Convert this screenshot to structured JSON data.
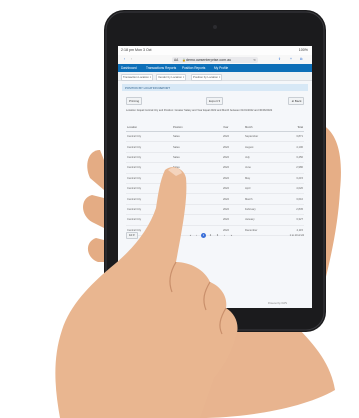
{
  "status": {
    "time": "2:18 pm  Mon 3 Oct",
    "battery": "100%"
  },
  "browser": {
    "tabs_label": "AA",
    "url": "demo.owsenterprise.com.au"
  },
  "nav": {
    "items": [
      "Dashboard",
      "Transactions Reports",
      "Position Reports",
      "My Profile"
    ]
  },
  "tabs": [
    {
      "label": "Transaction Location ×"
    },
    {
      "label": "Vendor by Location ×"
    },
    {
      "label": "Position by Location ×"
    }
  ],
  "panel": {
    "title": "POSITION BY LOCATION REPORT"
  },
  "toolbar": {
    "printing": "Printing",
    "export": "Export ▾",
    "back": "◄ Back"
  },
  "filter_text": "Location: Equal Central City and Position: Greater Salary and Year Equal 2022 and Month between 01/01/2022 and 30/06/2022",
  "table": {
    "headers": [
      "Location",
      "Position",
      "Year",
      "Month",
      "Total"
    ],
    "rows": [
      [
        "Central City",
        "Sales",
        "2022",
        "September",
        "3,871"
      ],
      [
        "Central City",
        "Sales",
        "2022",
        "August",
        "4,100"
      ],
      [
        "Central City",
        "Sales",
        "2022",
        "July",
        "3,450"
      ],
      [
        "Central City",
        "Sales",
        "2022",
        "June",
        "2,980"
      ],
      [
        "Central City",
        "Sales",
        "2022",
        "May",
        "3,215"
      ],
      [
        "Central City",
        "Sales",
        "2022",
        "April",
        "4,020"
      ],
      [
        "Central City",
        "Sales",
        "2022",
        "March",
        "3,610"
      ],
      [
        "Central City",
        "Sales",
        "2022",
        "February",
        "2,845"
      ],
      [
        "Central City",
        "Sales",
        "2022",
        "January",
        "3,327"
      ],
      [
        "Central City",
        "Sales",
        "2022",
        "December",
        "4,115"
      ]
    ]
  },
  "pagination": {
    "page_size": "10 ▾",
    "pages": [
      "«",
      "‹",
      "1",
      "2",
      "3",
      "›",
      "»"
    ],
    "summary": "1 to 10 of 24"
  },
  "footer": "Powered by OWS",
  "colors": {
    "nav": "#0d6fb8",
    "tablet_bezel": "#1b1b1d",
    "skin": "#e8b48f",
    "active_page": "#3b6fd8"
  }
}
